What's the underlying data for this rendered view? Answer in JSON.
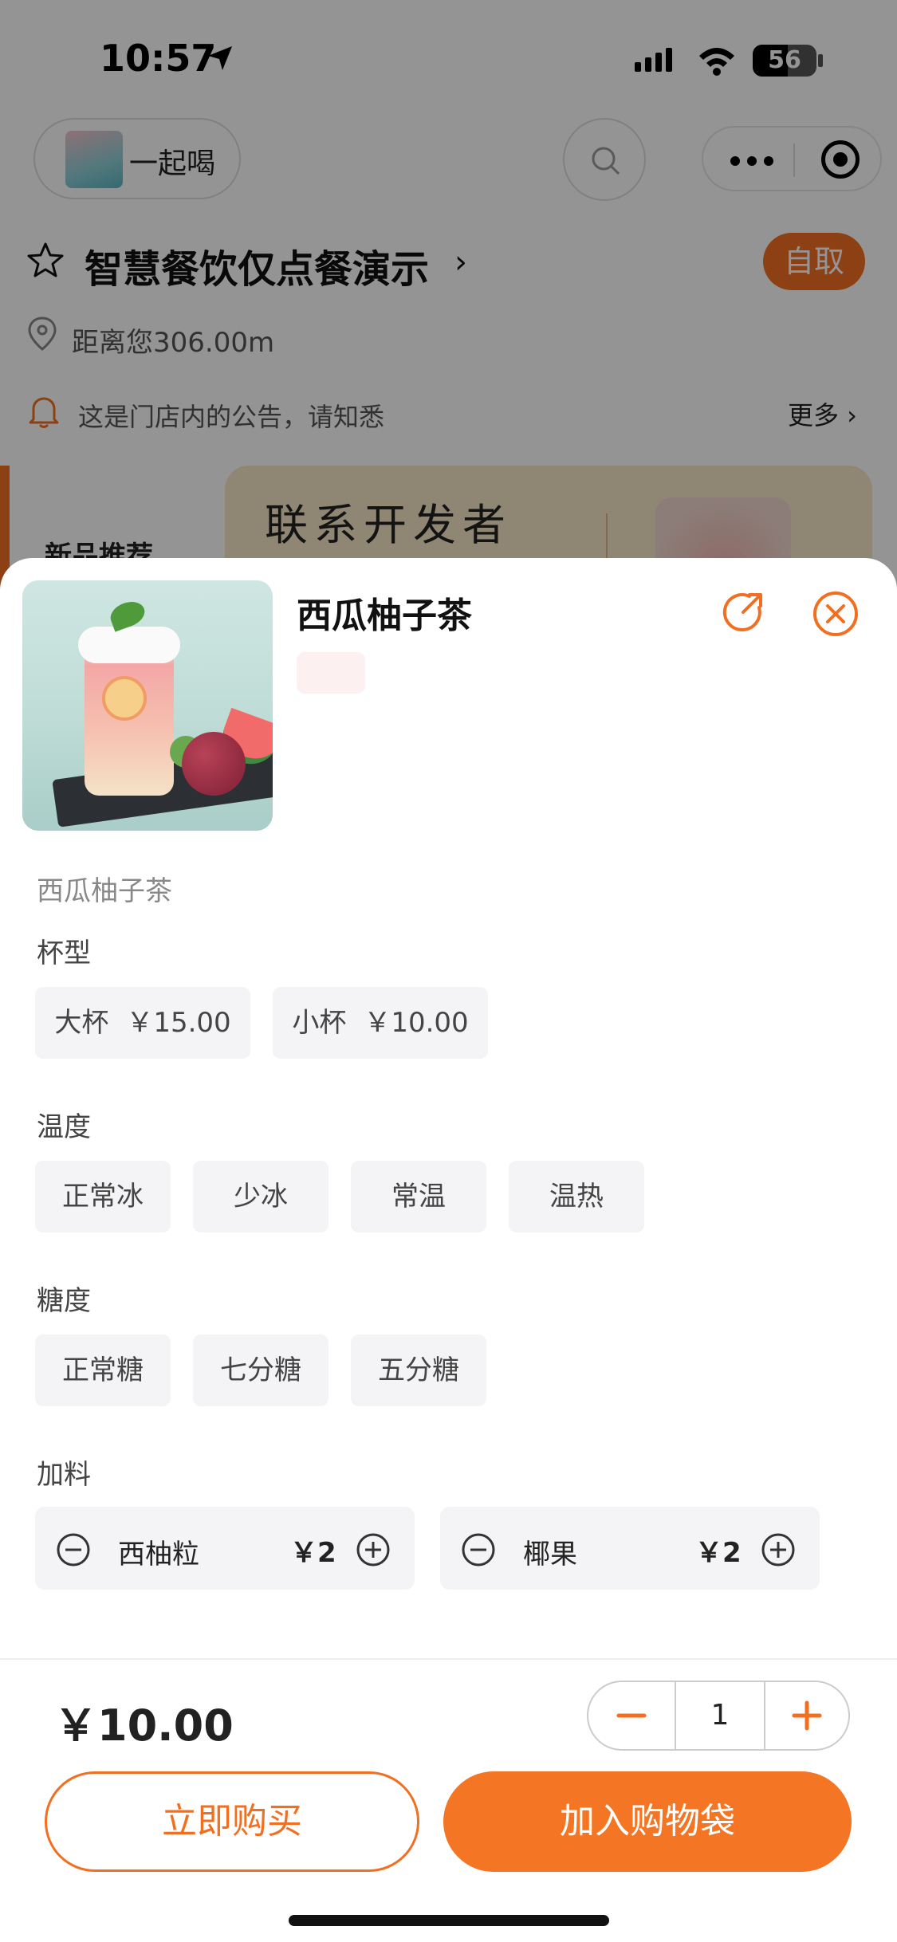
{
  "status_bar": {
    "time": "10:57",
    "battery": "56"
  },
  "header": {
    "brand_name": "一起喝"
  },
  "store": {
    "name": "智慧餐饮仅点餐演示",
    "pickup_badge": "自取",
    "distance": "距离您306.00m",
    "notice": "这是门店内的公告，请知悉",
    "more": "更多 ›"
  },
  "menu": {
    "category": "新品推荐",
    "banner_text": "联系开发者"
  },
  "product": {
    "title": "西瓜柚子茶",
    "description": "西瓜柚子茶"
  },
  "options": {
    "cup": {
      "label": "杯型",
      "choices": [
        {
          "name": "大杯",
          "price": "￥15.00"
        },
        {
          "name": "小杯",
          "price": "￥10.00"
        }
      ]
    },
    "temperature": {
      "label": "温度",
      "choices": [
        "正常冰",
        "少冰",
        "常温",
        "温热"
      ]
    },
    "sugar": {
      "label": "糖度",
      "choices": [
        "正常糖",
        "七分糖",
        "五分糖"
      ]
    },
    "toppings": {
      "label": "加料",
      "items": [
        {
          "name": "西柚粒",
          "price": "￥2"
        },
        {
          "name": "椰果",
          "price": "￥2"
        }
      ]
    }
  },
  "footer": {
    "total": "￥10.00",
    "quantity": "1",
    "buy_now": "立即购买",
    "add_to_bag": "加入购物袋"
  },
  "colors": {
    "accent": "#f26f21",
    "chip_bg": "#f4f4f6"
  },
  "icons": [
    "location-arrow-icon",
    "signal-icon",
    "wifi-icon",
    "battery-icon",
    "search-icon",
    "more-dots-icon",
    "target-icon",
    "star-icon",
    "pin-icon",
    "bell-icon",
    "share-icon",
    "close-icon",
    "minus-circle-icon",
    "plus-circle-icon"
  ]
}
